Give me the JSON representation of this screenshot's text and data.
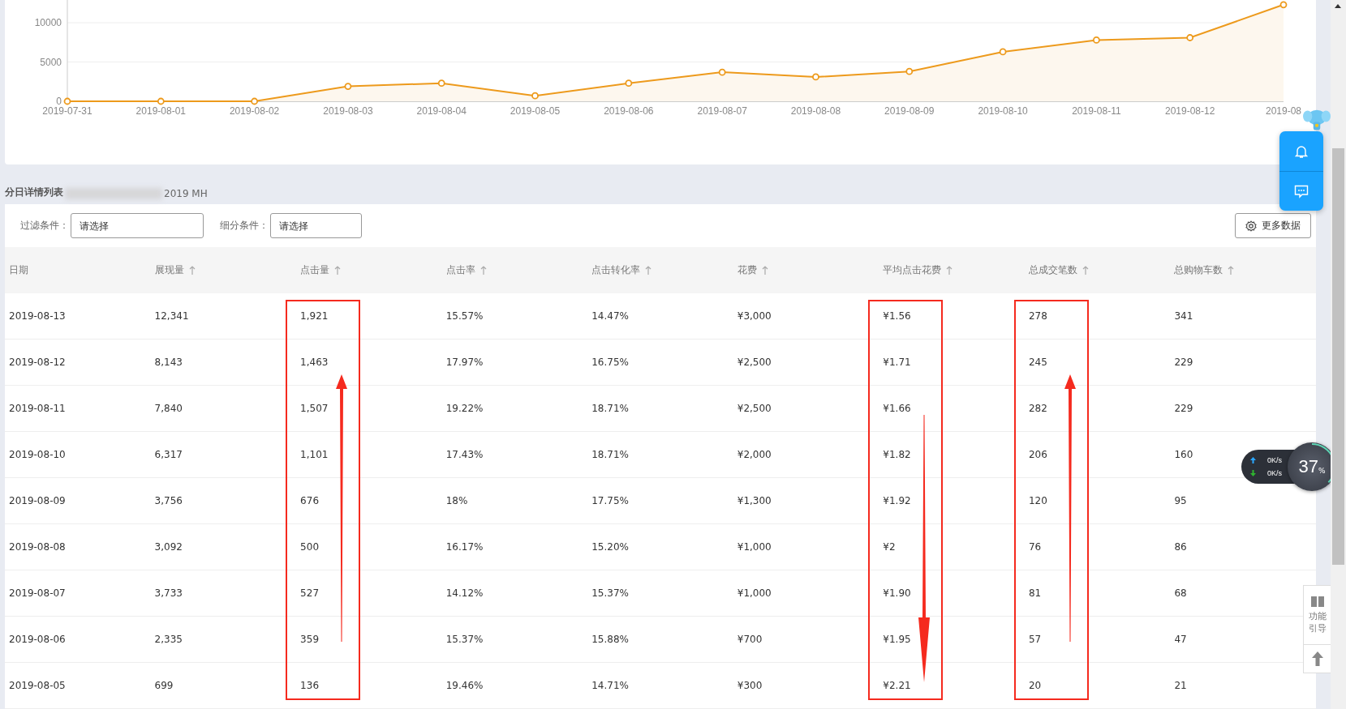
{
  "chart": {
    "chart_data": {
      "type": "area",
      "categories": [
        "2019-07-31",
        "2019-08-01",
        "2019-08-02",
        "2019-08-03",
        "2019-08-04",
        "2019-08-05",
        "2019-08-06",
        "2019-08-07",
        "2019-08-08",
        "2019-08-09",
        "2019-08-10",
        "2019-08-11",
        "2019-08-12",
        "2019-08"
      ],
      "series": [
        {
          "color": "#ed9a1c",
          "values": [
            0,
            0,
            0,
            1900,
            2300,
            700,
            2300,
            3700,
            3100,
            3800,
            6300,
            7800,
            8100,
            12300
          ]
        }
      ],
      "ylim": [
        0,
        12900
      ],
      "yticks": [
        0,
        5000,
        10000
      ]
    }
  },
  "detail_list": {
    "title": "分日详情列表",
    "suffix": "2019 MH"
  },
  "filters": [
    {
      "label": "过滤条件：",
      "placeholder": "请选择"
    },
    {
      "label": "细分条件：",
      "placeholder": "请选择"
    }
  ],
  "more_button": "更多数据",
  "table": {
    "columns": [
      {
        "label": "日期",
        "sortable": false
      },
      {
        "label": "展现量",
        "sortable": true
      },
      {
        "label": "点击量",
        "sortable": true
      },
      {
        "label": "点击率",
        "sortable": true
      },
      {
        "label": "点击转化率",
        "sortable": true
      },
      {
        "label": "花费",
        "sortable": true
      },
      {
        "label": "平均点击花费",
        "sortable": true
      },
      {
        "label": "总成交笔数",
        "sortable": true
      },
      {
        "label": "总购物车数",
        "sortable": true
      }
    ],
    "rows": [
      [
        "2019-08-13",
        "12,341",
        "1,921",
        "15.57%",
        "14.47%",
        "¥3,000",
        "¥1.56",
        "278",
        "341"
      ],
      [
        "2019-08-12",
        "8,143",
        "1,463",
        "17.97%",
        "16.75%",
        "¥2,500",
        "¥1.71",
        "245",
        "229"
      ],
      [
        "2019-08-11",
        "7,840",
        "1,507",
        "19.22%",
        "18.71%",
        "¥2,500",
        "¥1.66",
        "282",
        "229"
      ],
      [
        "2019-08-10",
        "6,317",
        "1,101",
        "17.43%",
        "18.71%",
        "¥2,000",
        "¥1.82",
        "206",
        "160"
      ],
      [
        "2019-08-09",
        "3,756",
        "676",
        "18%",
        "17.75%",
        "¥1,300",
        "¥1.92",
        "120",
        "95"
      ],
      [
        "2019-08-08",
        "3,092",
        "500",
        "16.17%",
        "15.20%",
        "¥1,000",
        "¥2",
        "76",
        "86"
      ],
      [
        "2019-08-07",
        "3,733",
        "527",
        "14.12%",
        "15.37%",
        "¥1,000",
        "¥1.90",
        "81",
        "68"
      ],
      [
        "2019-08-06",
        "2,335",
        "359",
        "15.37%",
        "15.88%",
        "¥700",
        "¥1.95",
        "57",
        "47"
      ],
      [
        "2019-08-05",
        "699",
        "136",
        "19.46%",
        "14.71%",
        "¥300",
        "¥2.21",
        "20",
        "21"
      ]
    ]
  },
  "net_monitor": {
    "upload": "0K/s",
    "download": "0K/s",
    "percent": "37",
    "unit": "%"
  },
  "guide": {
    "label": "功能引导"
  }
}
